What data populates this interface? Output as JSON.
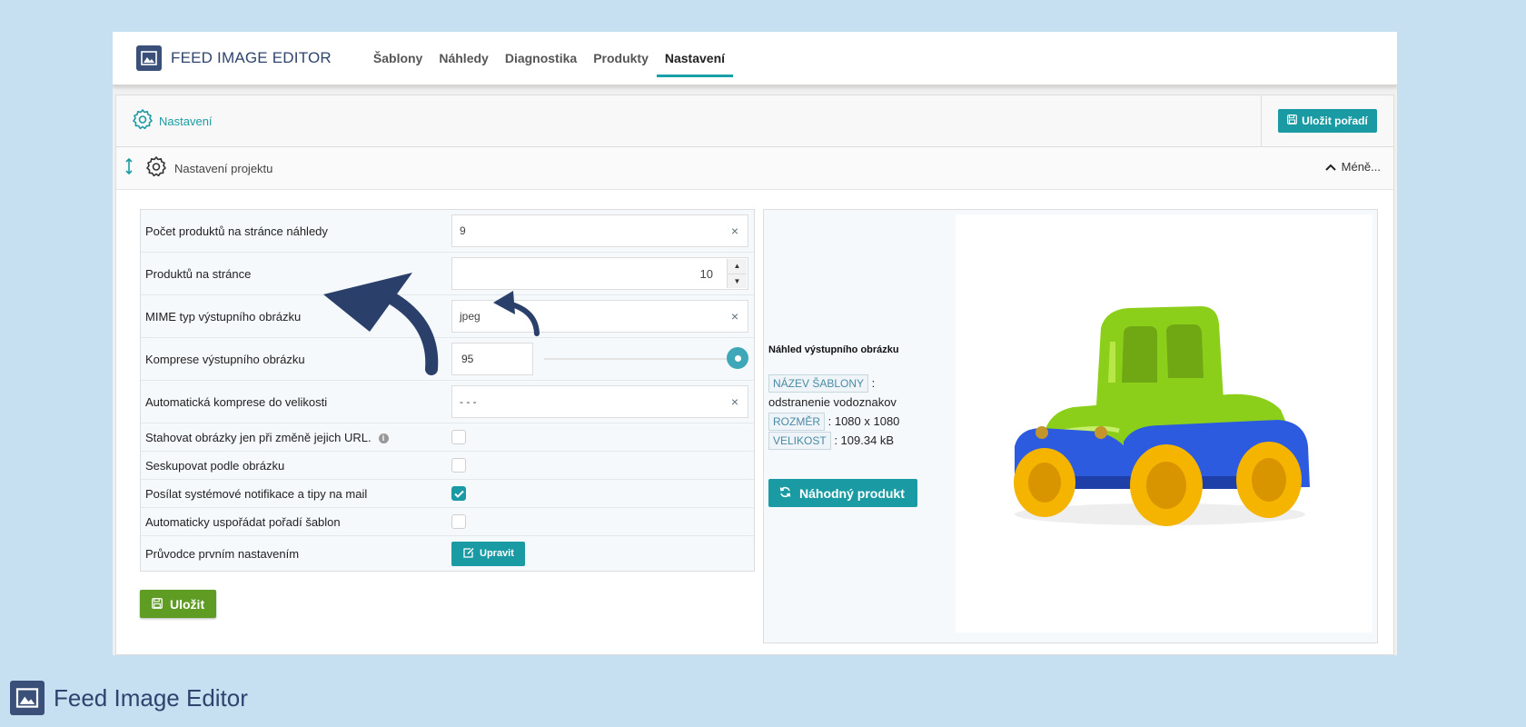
{
  "app": {
    "logo_text": "FEED IMAGE EDITOR",
    "brand_footer": "Feed Image Editor"
  },
  "nav": {
    "items": [
      {
        "label": "Šablony"
      },
      {
        "label": "Náhledy"
      },
      {
        "label": "Diagnostika"
      },
      {
        "label": "Produkty"
      },
      {
        "label": "Nastavení",
        "active": true
      }
    ]
  },
  "panel": {
    "title": "Nastavení",
    "save_order_label": "Uložit pořadí"
  },
  "section": {
    "title": "Nastavení projektu",
    "collapse_label": "Méně..."
  },
  "form": {
    "products_preview": {
      "label": "Počet produktů na stránce náhledy",
      "value": "9"
    },
    "products_page": {
      "label": "Produktů na stránce",
      "value": "10"
    },
    "mime": {
      "label": "MIME typ výstupního obrázku",
      "value": "jpeg"
    },
    "compression": {
      "label": "Komprese výstupního obrázku",
      "value": "95",
      "slider_fraction": 1.0
    },
    "auto_compress": {
      "label": "Automatická komprese do velikosti",
      "value": "- - -"
    },
    "download_on_change": {
      "label": "Stahovat obrázky jen při změně jejich URL.",
      "checked": false
    },
    "group_by_image": {
      "label": "Seskupovat podle obrázku",
      "checked": false
    },
    "notifications": {
      "label": "Posílat systémové notifikace a tipy na mail",
      "checked": true
    },
    "auto_order": {
      "label": "Automaticky uspořádat pořadí šablon",
      "checked": false
    },
    "wizard": {
      "label": "Průvodce prvním nastavením",
      "button": "Upravit"
    },
    "save_label": "Uložit"
  },
  "preview": {
    "title": "Náhled výstupního obrázku",
    "template_tag": "NÁZEV ŠABLONY",
    "template_value": "odstranenie vodoznakov",
    "size_tag": "ROZMĚR",
    "size_value": ": 1080 x 1080",
    "weight_tag": "VELIKOST",
    "weight_value": ": 109.34 kB",
    "random_button": "Náhodný produkt"
  },
  "colors": {
    "accent": "#1a9ba3",
    "save_green": "#5f9c23",
    "brand_navy": "#2f446d",
    "background": "#c6dff1"
  }
}
